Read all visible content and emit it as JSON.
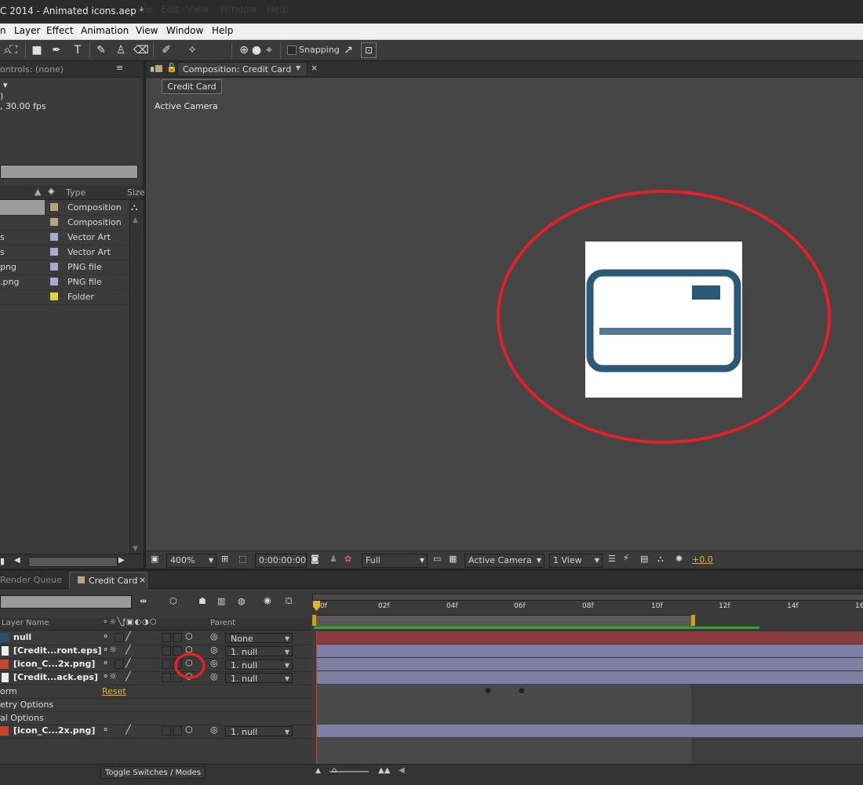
{
  "window": {
    "title": "C 2014 - Animated icons.aep *",
    "ghost_menu": [
      "File",
      "Edit",
      "View",
      "Window",
      "Help"
    ]
  },
  "menu": [
    "n",
    "Layer",
    "Effect",
    "Animation",
    "View",
    "Window",
    "Help"
  ],
  "toolbar": {
    "snapping_label": "Snapping"
  },
  "project": {
    "effect_controls": "ontrols: (none)",
    "info_lines": [
      "▾",
      ")",
      ", 30.00 fps"
    ],
    "col_type": "Type",
    "col_size": "Size",
    "items": [
      {
        "name": "",
        "type": "Composition",
        "color": "#b5a583"
      },
      {
        "name": "",
        "type": "Composition",
        "color": "#b5a583"
      },
      {
        "name": "s",
        "type": "Vector Art",
        "color": "#a9a9d6"
      },
      {
        "name": "s",
        "type": "Vector Art",
        "color": "#a9a9d6"
      },
      {
        "name": "png",
        "type": "PNG file",
        "color": "#a9a9d6"
      },
      {
        "name": ".png",
        "type": "PNG file",
        "color": "#a9a9d6"
      },
      {
        "name": "",
        "type": "Folder",
        "color": "#e6d33c"
      }
    ]
  },
  "composition": {
    "tab_label": "Composition: Credit Card",
    "breadcrumb": "Credit Card",
    "view_label": "Active Camera",
    "footer": {
      "zoom": "400%",
      "timecode": "0:00:00:00",
      "resolution": "Full",
      "camera": "Active Camera",
      "views": "1 View",
      "exposure": "+0.0"
    }
  },
  "timeline": {
    "tabs": [
      {
        "label": "Render Queue"
      },
      {
        "label": "Credit Card"
      }
    ],
    "col_layer_name": "Layer Name",
    "col_parent": "Parent",
    "ruler": [
      "0f",
      "02f",
      "04f",
      "06f",
      "08f",
      "10f",
      "12f",
      "14f",
      "16"
    ],
    "layers": [
      {
        "name": "null",
        "parent": "None"
      },
      {
        "name": "[Credit...ront.eps]",
        "parent": "1. null"
      },
      {
        "name": "[icon_C...2x.png]",
        "parent": "1. null"
      },
      {
        "name": "[Credit...ack.eps]",
        "parent": "1. null"
      }
    ],
    "props": [
      {
        "name": "orm",
        "value": "Reset"
      },
      {
        "name": "etry Options",
        "value": ""
      },
      {
        "name": "al Options",
        "value": ""
      }
    ],
    "extra_layer": {
      "name": "[icon_C...2x.png]",
      "parent": "1. null"
    },
    "toggle_label": "Toggle Switches / Modes"
  },
  "colors": {
    "highlight_circle": "#e1202a",
    "credit_card_icon": "#2b5877",
    "null_bar": "#8a3b3c",
    "layer_bar": "#7f7fa3"
  }
}
